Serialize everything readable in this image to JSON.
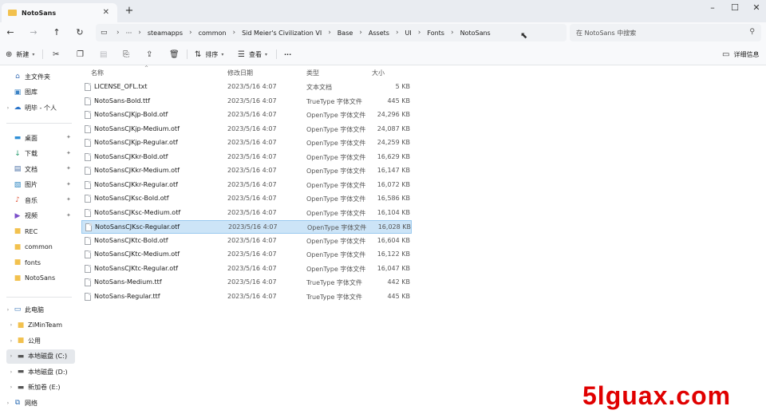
{
  "tab": {
    "title": "NotoSans"
  },
  "address": {
    "crumbs": [
      "steamapps",
      "common",
      "Sid Meier's Civilization VI",
      "Base",
      "Assets",
      "UI",
      "Fonts",
      "NotoSans"
    ],
    "ellipsis": "···"
  },
  "search": {
    "placeholder": "在 NotoSans 中搜索"
  },
  "toolbar": {
    "new_label": "新建",
    "sort_label": "排序",
    "view_label": "查看",
    "more_label": "···",
    "details_label": "详细信息"
  },
  "sidebar": {
    "quick": [
      {
        "label": "主文件夹",
        "icon": "home-icon"
      },
      {
        "label": "图库",
        "icon": "gallery-icon"
      },
      {
        "label": "明毕 - 个人",
        "icon": "cloud-icon"
      }
    ],
    "pinned": [
      {
        "label": "桌面",
        "icon": "desktop-icon"
      },
      {
        "label": "下载",
        "icon": "download-icon"
      },
      {
        "label": "文档",
        "icon": "documents-icon"
      },
      {
        "label": "图片",
        "icon": "pictures-icon"
      },
      {
        "label": "音乐",
        "icon": "music-icon"
      },
      {
        "label": "视频",
        "icon": "videos-icon"
      },
      {
        "label": "REC",
        "icon": "folder-icon"
      },
      {
        "label": "common",
        "icon": "folder-icon"
      },
      {
        "label": "fonts",
        "icon": "folder-icon"
      },
      {
        "label": "NotoSans",
        "icon": "folder-icon"
      }
    ],
    "thispc": {
      "label": "此电脑",
      "icon": "pc-icon"
    },
    "drives": [
      {
        "label": "ZiMinTeam",
        "icon": "folder-icon"
      },
      {
        "label": "公用",
        "icon": "folder-icon"
      },
      {
        "label": "本地磁盘 (C:)",
        "icon": "drive-icon"
      },
      {
        "label": "本地磁盘 (D:)",
        "icon": "drive-icon"
      },
      {
        "label": "新加卷 (E:)",
        "icon": "drive-icon"
      }
    ],
    "network": {
      "label": "网络",
      "icon": "network-icon"
    }
  },
  "columns": {
    "name": "名称",
    "date": "修改日期",
    "type": "类型",
    "size": "大小"
  },
  "files": [
    {
      "name": "LICENSE_OFL.txt",
      "date": "2023/5/16 4:07",
      "type": "文本文档",
      "size": "5 KB"
    },
    {
      "name": "NotoSans-Bold.ttf",
      "date": "2023/5/16 4:07",
      "type": "TrueType 字体文件",
      "size": "445 KB"
    },
    {
      "name": "NotoSansCJKjp-Bold.otf",
      "date": "2023/5/16 4:07",
      "type": "OpenType 字体文件",
      "size": "24,296 KB"
    },
    {
      "name": "NotoSansCJKjp-Medium.otf",
      "date": "2023/5/16 4:07",
      "type": "OpenType 字体文件",
      "size": "24,087 KB"
    },
    {
      "name": "NotoSansCJKjp-Regular.otf",
      "date": "2023/5/16 4:07",
      "type": "OpenType 字体文件",
      "size": "24,259 KB"
    },
    {
      "name": "NotoSansCJKkr-Bold.otf",
      "date": "2023/5/16 4:07",
      "type": "OpenType 字体文件",
      "size": "16,629 KB"
    },
    {
      "name": "NotoSansCJKkr-Medium.otf",
      "date": "2023/5/16 4:07",
      "type": "OpenType 字体文件",
      "size": "16,147 KB"
    },
    {
      "name": "NotoSansCJKkr-Regular.otf",
      "date": "2023/5/16 4:07",
      "type": "OpenType 字体文件",
      "size": "16,072 KB"
    },
    {
      "name": "NotoSansCJKsc-Bold.otf",
      "date": "2023/5/16 4:07",
      "type": "OpenType 字体文件",
      "size": "16,586 KB"
    },
    {
      "name": "NotoSansCJKsc-Medium.otf",
      "date": "2023/5/16 4:07",
      "type": "OpenType 字体文件",
      "size": "16,104 KB"
    },
    {
      "name": "NotoSansCJKsc-Regular.otf",
      "date": "2023/5/16 4:07",
      "type": "OpenType 字体文件",
      "size": "16,028 KB"
    },
    {
      "name": "NotoSansCJKtc-Bold.otf",
      "date": "2023/5/16 4:07",
      "type": "OpenType 字体文件",
      "size": "16,604 KB"
    },
    {
      "name": "NotoSansCJKtc-Medium.otf",
      "date": "2023/5/16 4:07",
      "type": "OpenType 字体文件",
      "size": "16,122 KB"
    },
    {
      "name": "NotoSansCJKtc-Regular.otf",
      "date": "2023/5/16 4:07",
      "type": "OpenType 字体文件",
      "size": "16,047 KB"
    },
    {
      "name": "NotoSans-Medium.ttf",
      "date": "2023/5/16 4:07",
      "type": "TrueType 字体文件",
      "size": "442 KB"
    },
    {
      "name": "NotoSans-Regular.ttf",
      "date": "2023/5/16 4:07",
      "type": "TrueType 字体文件",
      "size": "445 KB"
    }
  ],
  "selected_index": 10,
  "watermark": "5lguax.com",
  "colors": {
    "selection": "#cce4f7",
    "selection_border": "#99c9ef",
    "folder": "#f2c14e",
    "watermark": "#e00000"
  }
}
